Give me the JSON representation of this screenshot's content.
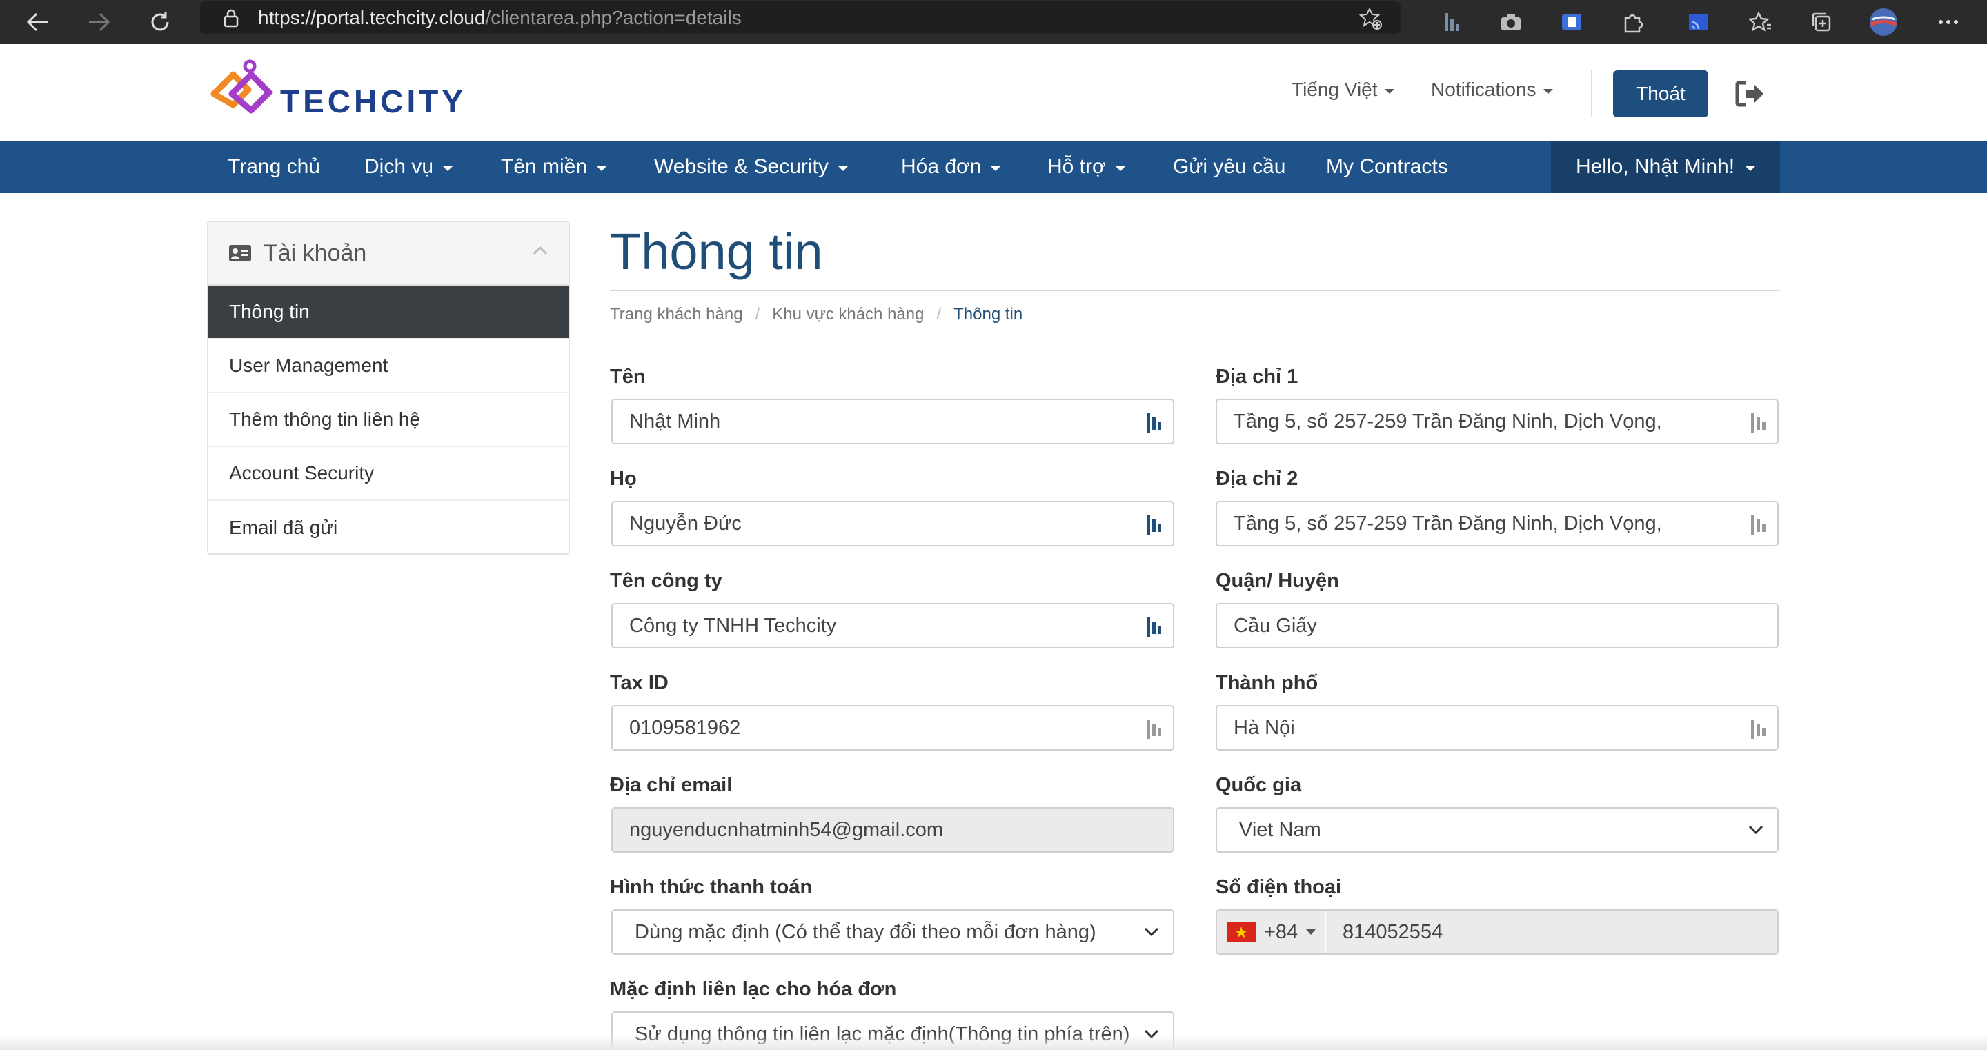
{
  "browser": {
    "url_main": "https://portal.techcity.cloud",
    "url_rest": "/clientarea.php?action=details"
  },
  "header": {
    "logo_text": "TECHCITY",
    "language": "Tiếng Việt",
    "notifications": "Notifications",
    "logout": "Thoát"
  },
  "nav": {
    "items": [
      {
        "label": "Trang chủ"
      },
      {
        "label": "Dịch vụ"
      },
      {
        "label": "Tên miền"
      },
      {
        "label": "Website & Security"
      },
      {
        "label": "Hóa đơn"
      },
      {
        "label": "Hỗ trợ"
      },
      {
        "label": "Gửi yêu cầu"
      },
      {
        "label": "My Contracts"
      }
    ],
    "user": "Hello, Nhật Minh!"
  },
  "sidebar": {
    "title": "Tài khoản",
    "items": [
      {
        "label": "Thông tin"
      },
      {
        "label": "User Management"
      },
      {
        "label": "Thêm thông tin liên hệ"
      },
      {
        "label": "Account Security"
      },
      {
        "label": "Email đã gửi"
      }
    ]
  },
  "page": {
    "title": "Thông tin",
    "breadcrumb": [
      "Trang khách hàng",
      "Khu vực khách hàng",
      "Thông tin"
    ]
  },
  "form": {
    "first_name": {
      "label": "Tên",
      "value": "Nhật Minh"
    },
    "last_name": {
      "label": "Họ",
      "value": "Nguyễn Đức"
    },
    "company": {
      "label": "Tên công ty",
      "value": "Công ty TNHH Techcity"
    },
    "tax_id": {
      "label": "Tax ID",
      "value": "0109581962"
    },
    "email": {
      "label": "Địa chỉ email",
      "value": "nguyenducnhatminh54@gmail.com"
    },
    "payment": {
      "label": "Hình thức thanh toán",
      "value": "Dùng mặc định (Có thể thay đổi theo mỗi đơn hàng)"
    },
    "billing_contact": {
      "label": "Mặc định liên lạc cho hóa đơn",
      "value": "Sử dụng thông tin liên lạc mặc định(Thông tin phía trên)"
    },
    "address1": {
      "label": "Địa chỉ 1",
      "value": "Tầng 5, số 257-259 Trần Đăng Ninh, Dịch Vọng,"
    },
    "address2": {
      "label": "Địa chỉ 2",
      "value": "Tầng 5, số 257-259 Trần Đăng Ninh, Dịch Vọng,"
    },
    "district": {
      "label": "Quận/ Huyện",
      "value": "Cầu Giấy"
    },
    "city": {
      "label": "Thành phố",
      "value": "Hà Nội"
    },
    "country": {
      "label": "Quốc gia",
      "value": "Viet Nam"
    },
    "phone": {
      "label": "Số điện thoại",
      "code": "+84",
      "value": "814052554"
    }
  },
  "colors": {
    "nav_bg": "#1f5288",
    "nav_active": "#173f68",
    "title": "#1f4e79",
    "sidebar_active": "#3a3f44"
  }
}
